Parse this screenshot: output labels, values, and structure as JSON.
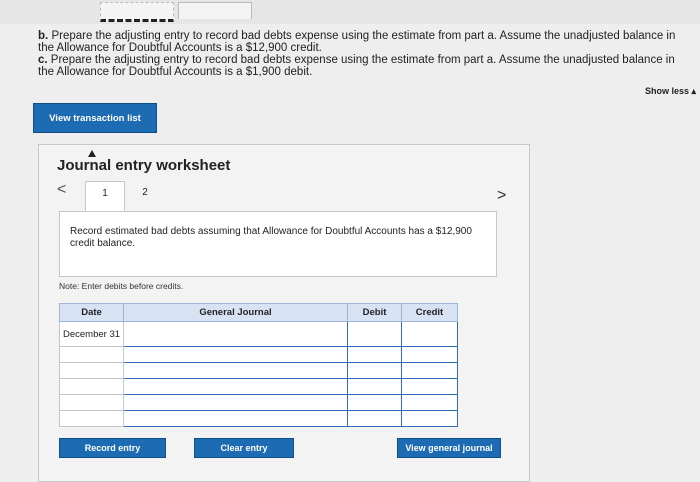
{
  "instructions": {
    "b_label": "b.",
    "b_text": "Prepare the adjusting entry to record bad debts expense using the estimate from part a. Assume the unadjusted balance in the Allowance for Doubtful Accounts is a $12,900 credit.",
    "c_label": "c.",
    "c_text": "Prepare the adjusting entry to record bad debts expense using the estimate from part a. Assume the unadjusted balance in the Allowance for Doubtful Accounts is a $1,900 debit."
  },
  "show_less": "Show less ▴",
  "view_transaction_list": "View transaction list",
  "worksheet": {
    "title": "Journal entry worksheet",
    "prev": "<",
    "next": ">",
    "tabs": [
      "1",
      "2"
    ],
    "description": "Record estimated bad debts assuming that Allowance for Doubtful Accounts has a $12,900 credit balance.",
    "note": "Note: Enter debits before credits."
  },
  "table": {
    "headers": {
      "date": "Date",
      "journal": "General Journal",
      "debit": "Debit",
      "credit": "Credit"
    },
    "first_date": "December 31"
  },
  "buttons": {
    "record": "Record entry",
    "clear": "Clear entry",
    "view_general": "View general journal"
  }
}
